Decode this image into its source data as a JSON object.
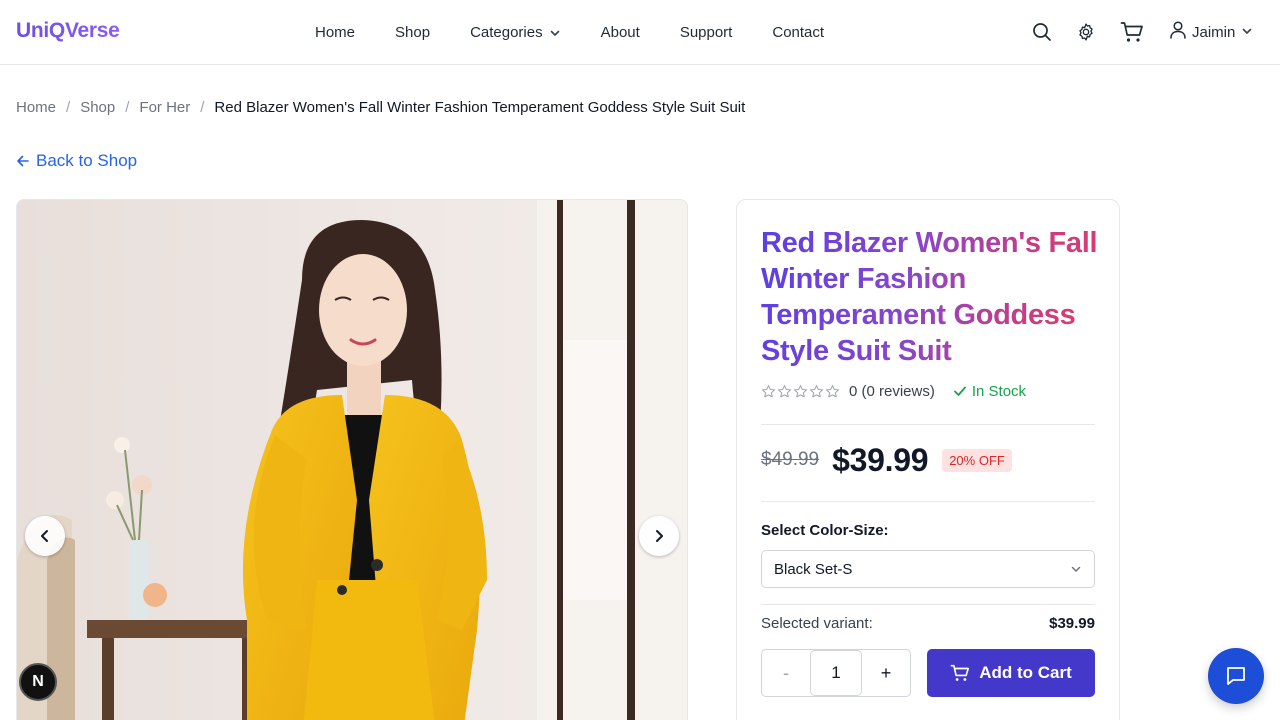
{
  "header": {
    "logo": "UniQVerse",
    "nav": [
      {
        "label": "Home"
      },
      {
        "label": "Shop"
      },
      {
        "label": "Categories"
      },
      {
        "label": "About"
      },
      {
        "label": "Support"
      },
      {
        "label": "Contact"
      }
    ],
    "icons": [
      "search-icon",
      "settings-icon",
      "cart-icon",
      "user-icon"
    ],
    "user_name": "Jaimin"
  },
  "breadcrumb": {
    "items": [
      "Home",
      "Shop",
      "For Her"
    ],
    "current": "Red Blazer Women's Fall Winter Fashion Temperament Goddess Style Suit Suit"
  },
  "back_link": "Back to Shop",
  "product": {
    "title": "Red Blazer Women's Fall Winter Fashion Temperament Goddess Style Suit Suit",
    "rating_value": 0,
    "rating_text": "0 (0 reviews)",
    "stock": "In Stock",
    "old_price": "$49.99",
    "price": "$39.99",
    "discount": "20% OFF",
    "select_label": "Select Color-Size:",
    "selected_option": "Black Set-S",
    "variant_label": "Selected variant:",
    "variant_price": "$39.99",
    "qty_minus": "-",
    "quantity": "1",
    "qty_plus": "+",
    "add_to_cart": "Add to Cart"
  },
  "badge_letter": "N",
  "colors": {
    "accent": "#4338ca",
    "link": "#2563eb",
    "in_stock": "#16a34a",
    "discount": "#dc2626",
    "chat_fab": "#1d4ed8"
  }
}
